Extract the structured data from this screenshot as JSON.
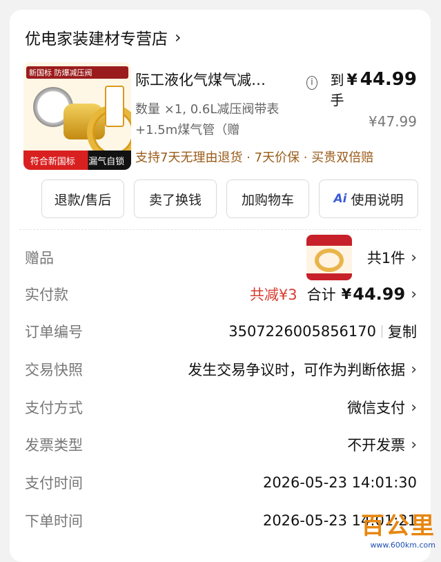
{
  "store": {
    "name": "优电家装建材专营店"
  },
  "product": {
    "title": "际工液化气煤气减…",
    "image_banner": "新国标 防爆减压阀",
    "image_footer_left": "符合新国标",
    "image_footer_right": "漏气自锁",
    "price_label": "到手",
    "currency": "¥",
    "price": "44.99",
    "original_price": "¥47.99",
    "spec_line1": "数量 ×1, 0.6L减压阀带表",
    "spec_line2": "+1.5m煤气管（赠",
    "service": "支持7天无理由退货 · 7天价保 · 买贵双倍赔"
  },
  "actions": [
    {
      "label": "退款/售后"
    },
    {
      "label": "卖了换钱"
    },
    {
      "label": "加购物车"
    },
    {
      "label": "使用说明",
      "icon": "ai-icon"
    }
  ],
  "details": {
    "gift": {
      "label": "赠品",
      "value": "共1件"
    },
    "paid": {
      "label": "实付款",
      "discount": "共减¥3",
      "total_label": "合计",
      "total_currency": "¥",
      "total_value": "44.99"
    },
    "order_no": {
      "label": "订单编号",
      "value": "3507226005856170",
      "copy": "复制"
    },
    "snapshot": {
      "label": "交易快照",
      "value": "发生交易争议时，可作为判断依据"
    },
    "pay_method": {
      "label": "支付方式",
      "value": "微信支付"
    },
    "invoice": {
      "label": "发票类型",
      "value": "不开发票"
    },
    "pay_time": {
      "label": "支付时间",
      "value": "2026-05-23 14:01:30"
    },
    "order_time": {
      "label": "下单时间",
      "value": "2026-05-23 14:01:21"
    }
  },
  "watermark": {
    "text": "百公里",
    "url": "www.600km.com"
  },
  "colors": {
    "accent_red": "#d63b2f",
    "service_brown": "#9a5b18"
  }
}
